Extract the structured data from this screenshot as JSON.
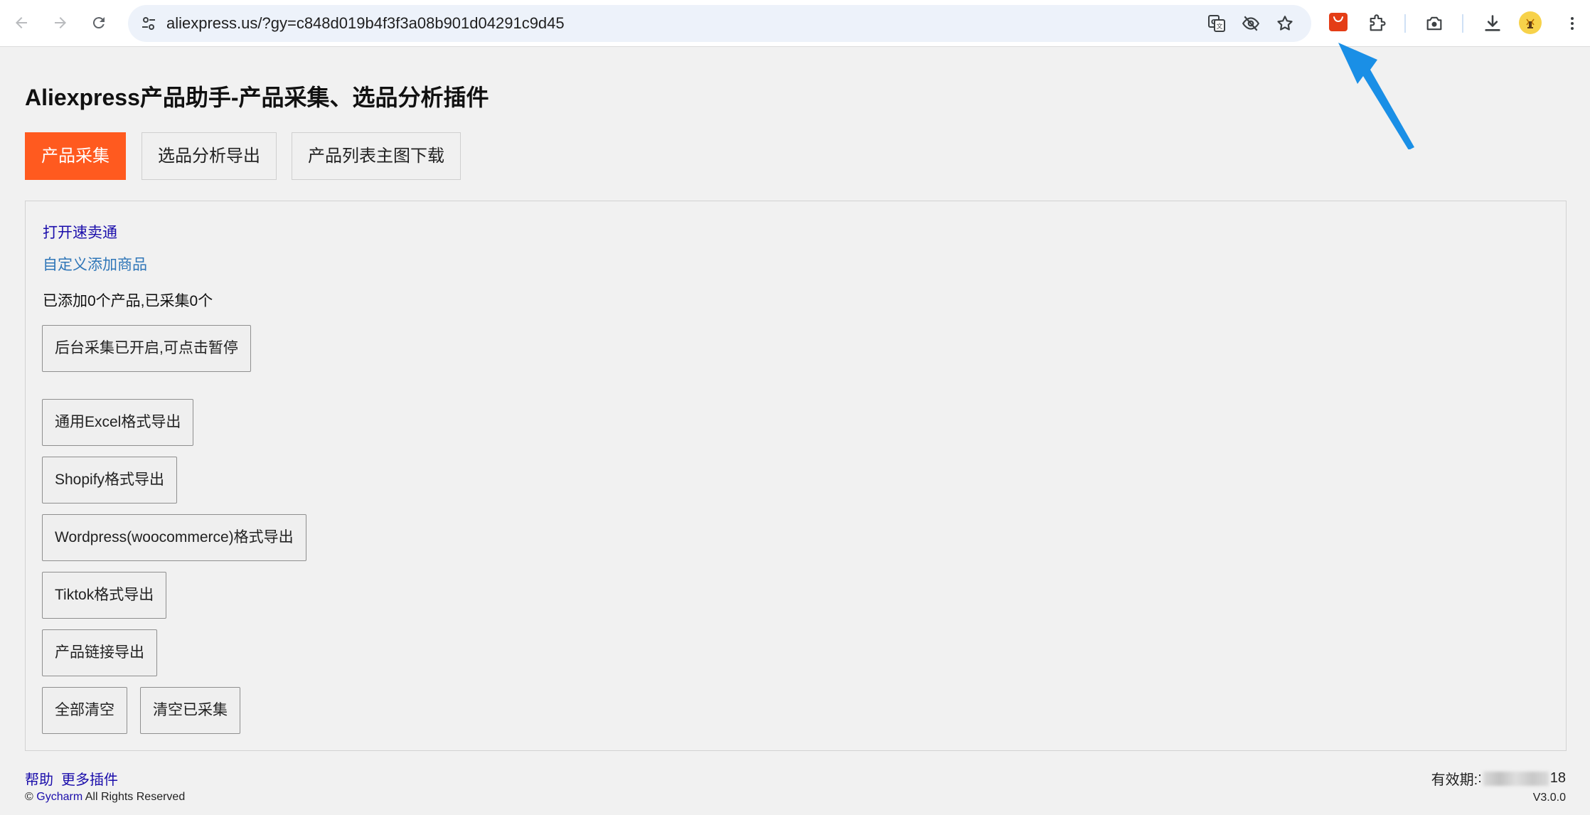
{
  "browser": {
    "url": "aliexpress.us/?gy=c848d019b4f3f3a08b901d04291c9d45",
    "icons": {
      "back": "arrow-left-icon",
      "forward": "arrow-right-icon",
      "reload": "reload-icon",
      "site_settings": "tune-icon",
      "translate": "translate-icon",
      "eye_off": "eye-off-icon",
      "bookmark": "star-icon",
      "extension_active": "shopping-bag-icon",
      "extensions": "puzzle-icon",
      "screenshot": "camera-icon",
      "download": "download-icon",
      "profile": "avatar",
      "menu": "more-vert-icon"
    },
    "accent_color": "#e43d16"
  },
  "page": {
    "title": "Aliexpress产品助手-产品采集、选品分析插件",
    "tabs": [
      {
        "label": "产品采集",
        "active": true
      },
      {
        "label": "选品分析导出",
        "active": false
      },
      {
        "label": "产品列表主图下载",
        "active": false
      }
    ],
    "accent_color": "#ff5a1f"
  },
  "panel": {
    "open_link": "打开速卖通",
    "custom_add_link": "自定义添加商品",
    "status": "已添加0个产品,已采集0个",
    "pause_button": "后台采集已开启,可点击暂停",
    "export_excel": "通用Excel格式导出",
    "export_shopify": "Shopify格式导出",
    "export_wordpress": "Wordpress(woocommerce)格式导出",
    "export_tiktok": "Tiktok格式导出",
    "export_links": "产品链接导出",
    "clear_all": "全部清空",
    "clear_collected": "清空已采集"
  },
  "footer": {
    "help": "帮助",
    "more_plugins": "更多插件",
    "copyright_prefix": "©",
    "copyright_brand": "Gycharm",
    "copyright_suffix": "All Rights Reserved",
    "validity_label": "有效期:",
    "validity_prefix": ":",
    "validity_suffix": "18",
    "version": "V3.0.0"
  }
}
